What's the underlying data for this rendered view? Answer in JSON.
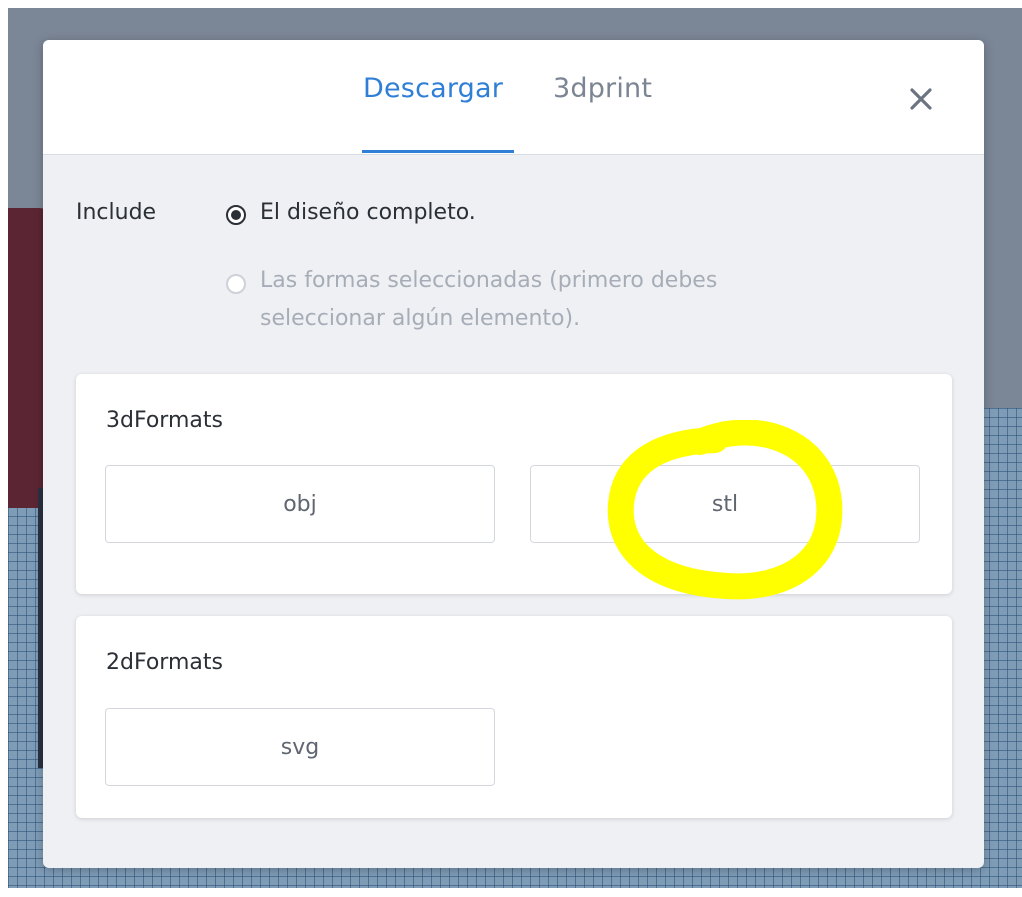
{
  "dialog": {
    "tabs": [
      {
        "label": "Descargar",
        "active": true
      },
      {
        "label": "3dprint",
        "active": false
      }
    ],
    "close_icon": "close-icon",
    "include_label": "Include",
    "options": [
      {
        "label": "El diseño completo.",
        "checked": true,
        "disabled": false
      },
      {
        "label": "Las formas seleccionadas (primero debes seleccionar algún elemento).",
        "checked": false,
        "disabled": true
      }
    ],
    "sections": [
      {
        "title": "3dFormats",
        "buttons": [
          "obj",
          "stl"
        ]
      },
      {
        "title": "2dFormats",
        "buttons": [
          "svg"
        ]
      }
    ]
  },
  "colors": {
    "accent": "#2f7fd6",
    "annotation": "#ffff00"
  }
}
